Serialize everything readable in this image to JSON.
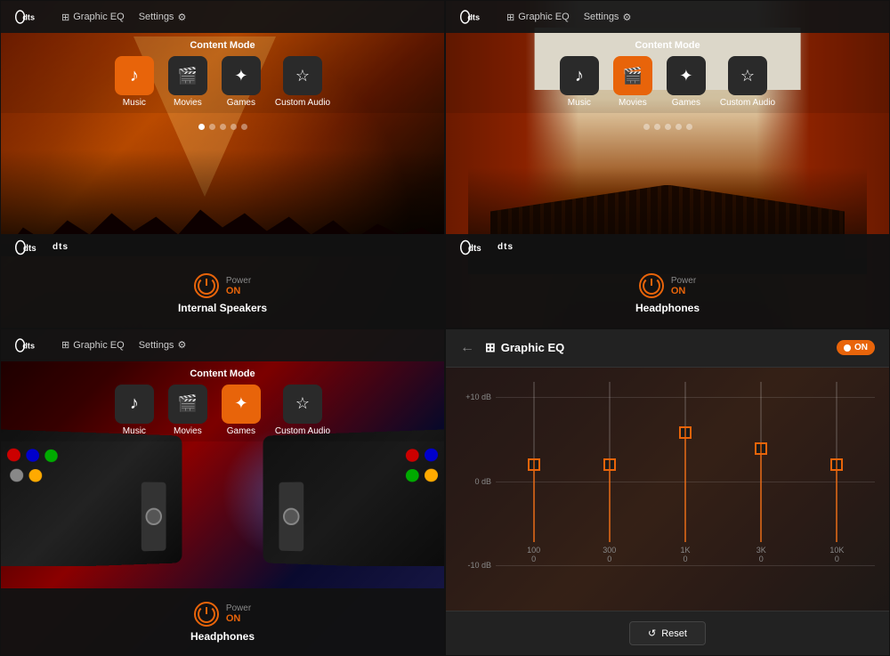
{
  "panels": [
    {
      "id": "concert",
      "nav": {
        "graphic_eq": "Graphic EQ",
        "settings": "Settings"
      },
      "content_mode": {
        "label": "Content Mode",
        "modes": [
          {
            "id": "music",
            "label": "Music",
            "icon": "♪",
            "active": true
          },
          {
            "id": "movies",
            "label": "Movies",
            "icon": "🎬",
            "active": false
          },
          {
            "id": "games",
            "label": "Games",
            "icon": "✦",
            "active": false
          },
          {
            "id": "custom",
            "label": "Custom Audio",
            "icon": "☆",
            "active": false
          }
        ]
      },
      "dots": [
        true,
        false,
        false,
        false,
        false
      ],
      "power": {
        "label": "Power",
        "status": "ON"
      },
      "device": "Internal Speakers"
    },
    {
      "id": "theater",
      "nav": {
        "graphic_eq": "Graphic EQ",
        "settings": "Settings"
      },
      "content_mode": {
        "label": "Content Mode",
        "modes": [
          {
            "id": "music",
            "label": "Music",
            "icon": "♪",
            "active": false
          },
          {
            "id": "movies",
            "label": "Movies",
            "icon": "🎬",
            "active": true
          },
          {
            "id": "games",
            "label": "Games",
            "icon": "✦",
            "active": false
          },
          {
            "id": "custom",
            "label": "Custom Audio",
            "icon": "☆",
            "active": false
          }
        ]
      },
      "dots": [
        false,
        false,
        false,
        false,
        false
      ],
      "power": {
        "label": "Power",
        "status": "ON"
      },
      "device": "Headphones"
    },
    {
      "id": "gaming",
      "nav": {
        "graphic_eq": "Graphic EQ",
        "settings": "Settings"
      },
      "content_mode": {
        "label": "Content Mode",
        "modes": [
          {
            "id": "music",
            "label": "Music",
            "icon": "♪",
            "active": false
          },
          {
            "id": "movies",
            "label": "Movies",
            "icon": "🎬",
            "active": false
          },
          {
            "id": "games",
            "label": "Games",
            "icon": "✦",
            "active": true
          },
          {
            "id": "custom",
            "label": "Custom Audio",
            "icon": "☆",
            "active": false
          }
        ]
      },
      "dots": [
        false,
        false,
        false,
        false,
        false
      ],
      "power": {
        "label": "Power",
        "status": "ON"
      },
      "device": "Headphones"
    }
  ],
  "eq_panel": {
    "back_button": "←",
    "title": "Graphic EQ",
    "toggle_label": "ON",
    "grid_labels": [
      "+10 dB",
      "0 dB",
      "-10 dB"
    ],
    "sliders": [
      {
        "freq": "100",
        "value": "0",
        "position": 50
      },
      {
        "freq": "300",
        "value": "0",
        "position": 50
      },
      {
        "freq": "1K",
        "value": "0",
        "position": 30
      },
      {
        "freq": "3K",
        "value": "0",
        "position": 40
      },
      {
        "freq": "10K",
        "value": "0",
        "position": 50
      }
    ],
    "reset_button": "Reset"
  },
  "colors": {
    "accent": "#E8640A",
    "bg_dark": "#1a1a1a",
    "bg_medium": "#222222",
    "text_primary": "#ffffff",
    "text_secondary": "#888888"
  }
}
